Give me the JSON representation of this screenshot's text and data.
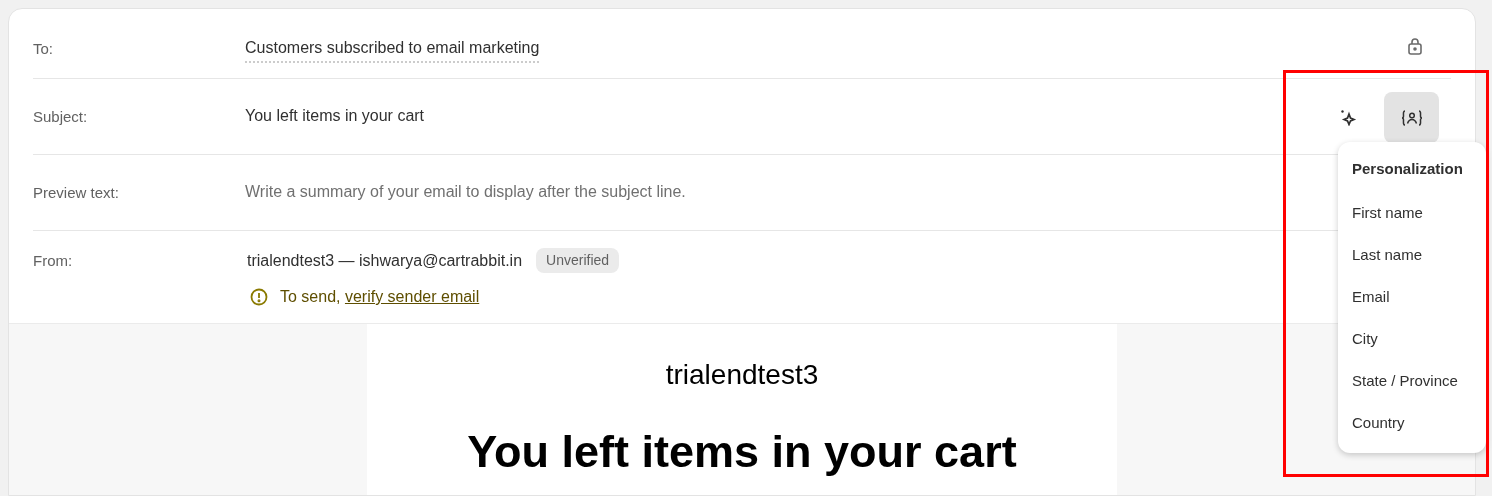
{
  "fields": [
    {
      "kind": "recipients",
      "label": "To:",
      "value": "Customers subscribed to email marketing"
    },
    {
      "kind": "subject",
      "label": "Subject:",
      "value": "You left items in your cart"
    },
    {
      "kind": "preview",
      "label": "Preview text:",
      "placeholder": "Write a summary of your email to display after the subject line."
    },
    {
      "kind": "sender",
      "label": "From:",
      "value": "trialendtest3 — ishwarya@cartrabbit.in",
      "badge": "Unverified",
      "warning": "To send, ",
      "warning_link": "verify sender email"
    }
  ],
  "personalization_menu": {
    "title": "Personalization",
    "items": [
      "First name",
      "Last name",
      "Email",
      "City",
      "State / Province",
      "Country"
    ]
  },
  "email_preview": {
    "store_name": "trialendtest3",
    "heading": "You left items in your cart"
  }
}
